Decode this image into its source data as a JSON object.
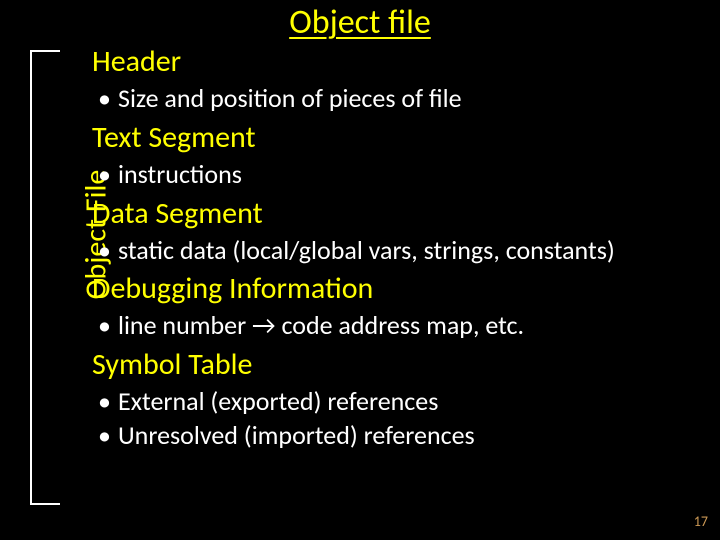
{
  "title": "Object file",
  "bracket_label": "Object File",
  "sections": [
    {
      "heading": "Header",
      "bullets": [
        "Size and position of pieces of file"
      ]
    },
    {
      "heading": "Text Segment",
      "bullets": [
        "instructions"
      ]
    },
    {
      "heading": "Data Segment",
      "bullets": [
        "static data (local/global vars, strings, constants)"
      ]
    },
    {
      "heading": "Debugging Information",
      "bullets": [
        "line number → code address map, etc."
      ]
    },
    {
      "heading": "Symbol Table",
      "bullets": [
        "External (exported) references",
        "Unresolved (imported) references"
      ]
    }
  ],
  "arrow_glyph": "→",
  "page_number": "17"
}
